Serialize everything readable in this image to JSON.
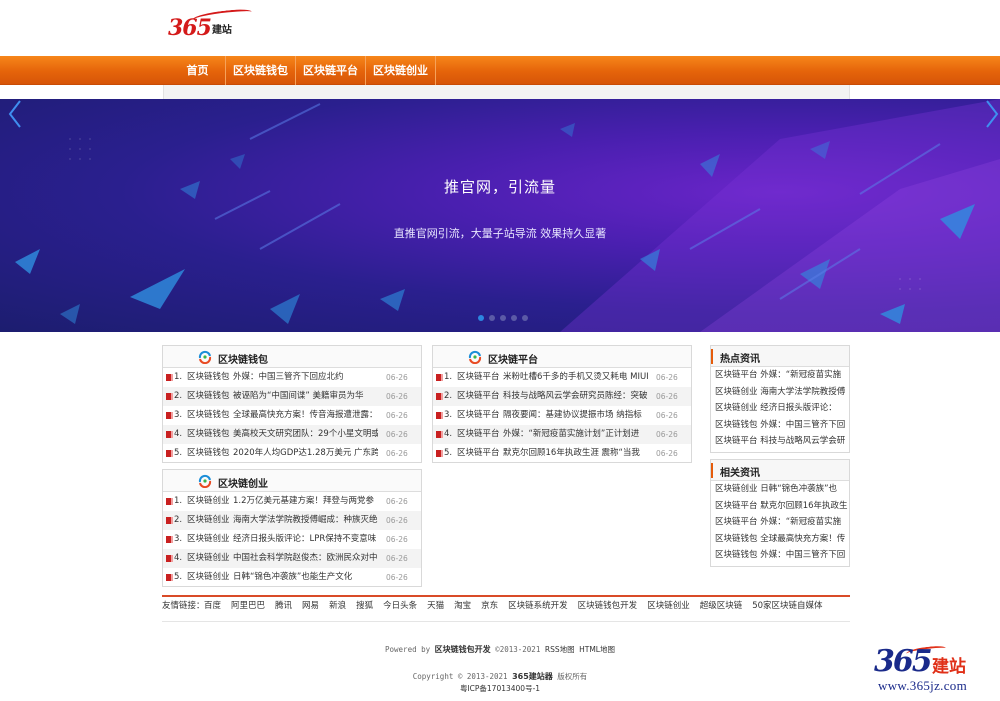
{
  "header": {
    "logo_num": "365",
    "logo_text": "建站"
  },
  "nav": {
    "items": [
      {
        "label": "首页"
      },
      {
        "label": "区块链钱包"
      },
      {
        "label": "区块链平台"
      },
      {
        "label": "区块链创业"
      }
    ]
  },
  "banner": {
    "title": "推官网，引流量",
    "subtitle": "直推官网引流，大量子站导流 效果持久显著",
    "slide_count": 5,
    "active_slide": 1
  },
  "colors": {
    "nav_orange": "#e5640a",
    "accent_red": "#d41a1a",
    "banner_purple": "#4a1fb0"
  },
  "panels": {
    "wallet": {
      "title": "区块链钱包",
      "rows": [
        {
          "num": "1.",
          "cat": "区块链钱包",
          "title": "外媒：中国三管齐下回应北约",
          "date": "06-26"
        },
        {
          "num": "2.",
          "cat": "区块链钱包",
          "title": "被诬陷为“中国间谍” 美籍审员为华",
          "date": "06-26"
        },
        {
          "num": "3.",
          "cat": "区块链钱包",
          "title": "全球最高快充方案！传音海报遭泄露：",
          "date": "06-26"
        },
        {
          "num": "4.",
          "cat": "区块链钱包",
          "title": "美高校天文研究团队：29个小星文明或",
          "date": "06-26"
        },
        {
          "num": "5.",
          "cat": "区块链钱包",
          "title": "2020年人均GDP达1.28万美元 广东跨入",
          "date": "06-26"
        }
      ]
    },
    "platform": {
      "title": "区块链平台",
      "rows": [
        {
          "num": "1.",
          "cat": "区块链平台",
          "title": "米粉吐槽6千多的手机又烫又耗电 MIUI",
          "date": "06-26"
        },
        {
          "num": "2.",
          "cat": "区块链平台",
          "title": "科技与战略风云学会研究员陈经：突破",
          "date": "06-26"
        },
        {
          "num": "3.",
          "cat": "区块链平台",
          "title": "隔夜要闻：基建协议提振市场 纳指标",
          "date": "06-26"
        },
        {
          "num": "4.",
          "cat": "区块链平台",
          "title": "外媒：“新冠疫苗实施计划”正计划进",
          "date": "06-26"
        },
        {
          "num": "5.",
          "cat": "区块链平台",
          "title": "默克尔回顾16年执政生涯 震称“当我",
          "date": "06-26"
        }
      ]
    },
    "startup": {
      "title": "区块链创业",
      "rows": [
        {
          "num": "1.",
          "cat": "区块链创业",
          "title": "1.2万亿美元基建方案！拜登与两党参",
          "date": "06-26"
        },
        {
          "num": "2.",
          "cat": "区块链创业",
          "title": "海南大学法学院教授傅崛成：种族灭绝",
          "date": "06-26"
        },
        {
          "num": "3.",
          "cat": "区块链创业",
          "title": "经济日报头版评论：LPR保持不变意味",
          "date": "06-26"
        },
        {
          "num": "4.",
          "cat": "区块链创业",
          "title": "中国社会科学院赵俊杰：欧洲民众对中",
          "date": "06-26"
        },
        {
          "num": "5.",
          "cat": "区块链创业",
          "title": "日韩“锦色冲袭族”也能生产文化",
          "date": "06-26"
        }
      ]
    }
  },
  "hot": {
    "title": "热点资讯",
    "items": [
      "区块链平台 外媒：“新冠疫苗实施",
      "区块链创业 海南大学法学院教授傅",
      "区块链创业 经济日报头版评论：",
      "区块链钱包 外媒：中国三管齐下回",
      "区块链平台 科技与战略风云学会研"
    ]
  },
  "related": {
    "title": "相关资讯",
    "items": [
      "区块链创业 日韩“锦色冲袭族”也",
      "区块链平台 默克尔回顾16年执政生",
      "区块链平台 外媒：“新冠疫苗实施",
      "区块链钱包 全球最高快充方案！传",
      "区块链钱包 外媒：中国三管齐下回"
    ]
  },
  "links": {
    "label": "友情链接：",
    "items": [
      "百度",
      "阿里巴巴",
      "腾讯",
      "网易",
      "新浪",
      "搜狐",
      "今日头条",
      "天猫",
      "淘宝",
      "京东",
      "区块链系统开发",
      "区块链钱包开发",
      "区块链创业",
      "超级区块链",
      "50家区块链自媒体"
    ]
  },
  "footer": {
    "powered_prefix": "Powered by ",
    "powered_link": "区块链钱包开发",
    "powered_suffix": " ©2013-2021 ",
    "rss": "RSS地图",
    "html_map": "HTML地图",
    "copyright_prefix": "Copyright © 2013-2021 ",
    "copyright_name": "365建站器",
    "copyright_suffix": " 版权所有",
    "icp": "粤ICP备17013400号-1"
  },
  "watermark": {
    "num": "365",
    "text": "建站",
    "url": "www.365jz.com"
  }
}
